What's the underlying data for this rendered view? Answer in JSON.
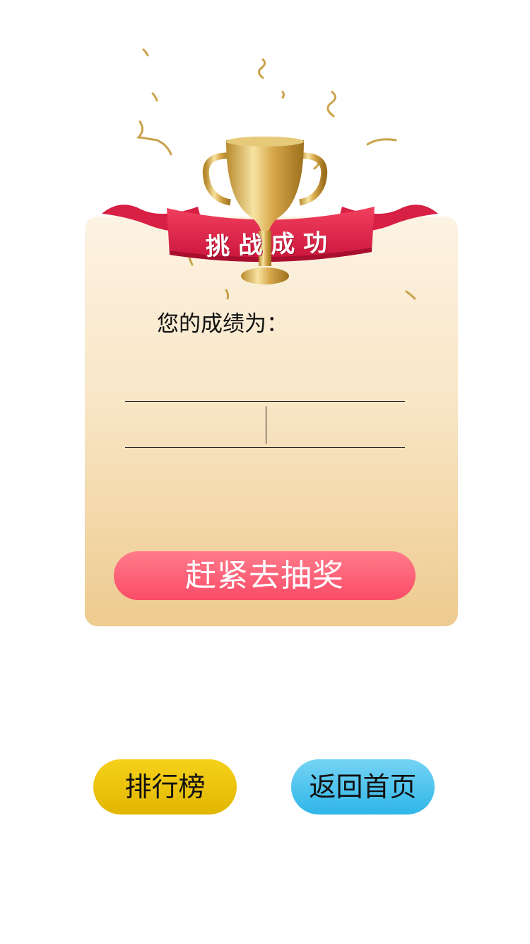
{
  "banner": {
    "title": "挑战成功"
  },
  "result": {
    "score_label": "您的成绩为：",
    "score_left": "",
    "score_right": ""
  },
  "actions": {
    "lottery_label": "赶紧去抽奖",
    "ranking_label": "排行榜",
    "home_label": "返回首页"
  },
  "colors": {
    "ribbon": "#e8284b",
    "lottery_button": "#fa4c67",
    "ranking_button": "#ecc300",
    "home_button": "#3fbdea",
    "card_top": "#fdf3e3",
    "card_bottom": "#eecb8f"
  },
  "icons": [
    "trophy-icon",
    "ribbon-banner",
    "confetti"
  ]
}
